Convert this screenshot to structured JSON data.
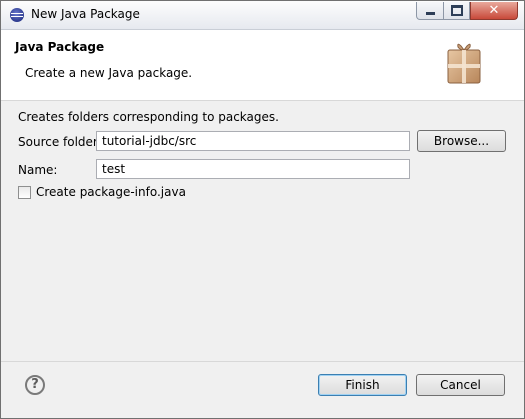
{
  "window": {
    "title": "New Java Package",
    "controls": {
      "minimize": "minimize",
      "maximize": "maximize",
      "close": "✕"
    }
  },
  "header": {
    "title": "Java Package",
    "description": "Create a new Java package.",
    "icon": "package-icon"
  },
  "form": {
    "intro": "Creates folders corresponding to packages.",
    "source_folder": {
      "label": "Source folder:",
      "value": "tutorial-jdbc/src"
    },
    "browse_label": "Browse...",
    "name": {
      "label": "Name:",
      "value": "test"
    },
    "package_info": {
      "label": "Create package-info.java",
      "checked": false
    }
  },
  "footer": {
    "help_glyph": "?",
    "finish_label": "Finish",
    "cancel_label": "Cancel"
  },
  "colors": {
    "title_bar": "#e6e9ef",
    "close_button": "#c8493a",
    "default_button_border": "#3c7fb1",
    "header_bg": "#ffffff",
    "dialog_bg": "#f0f0f0"
  }
}
